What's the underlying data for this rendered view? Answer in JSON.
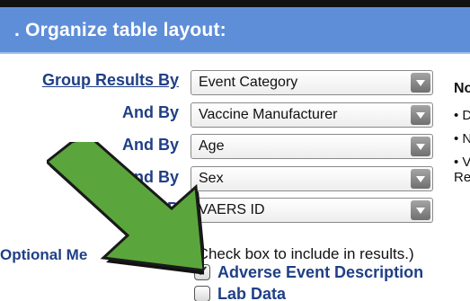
{
  "section": {
    "title": ". Organize table layout:"
  },
  "group_rows": [
    {
      "label": "Group Results By",
      "value": "Event Category"
    },
    {
      "label": "And By",
      "value": "Vaccine Manufacturer"
    },
    {
      "label": "And By",
      "value": "Age"
    },
    {
      "label": "nd By",
      "value": "Sex"
    },
    {
      "label": "B",
      "value": "VAERS ID"
    }
  ],
  "notes": {
    "title": "No",
    "lines": [
      "• D",
      "• N",
      "• V",
      "Re"
    ]
  },
  "optional": {
    "label": "Optional Me",
    "hint": "(Check box to include in results.)",
    "items": [
      {
        "label": "Adverse Event Description",
        "checked": true
      },
      {
        "label": "Lab Data",
        "checked": false
      }
    ]
  },
  "colors": {
    "header_bg": "#5f8ed8",
    "label_text": "#1f3f86",
    "arrow_fill": "#5aa63c"
  },
  "icons": {
    "select_button": "chevron-down-icon",
    "arrow": "pointer-arrow-icon"
  }
}
